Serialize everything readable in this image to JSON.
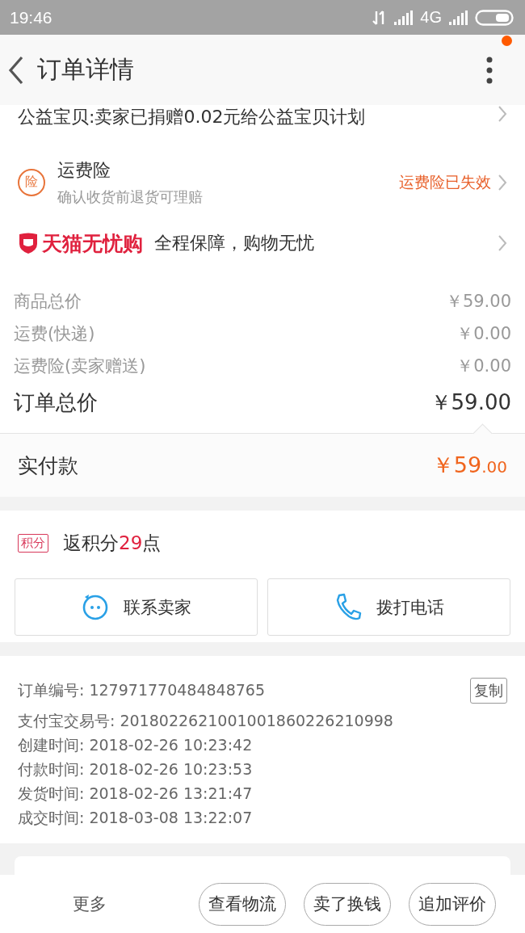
{
  "status_bar": {
    "time": "19:46",
    "network": "4G"
  },
  "header": {
    "title": "订单详情",
    "notification": true
  },
  "charity": {
    "text": "公益宝贝:卖家已捐赠0.02元给公益宝贝计划"
  },
  "insurance": {
    "badge": "险",
    "title": "运费险",
    "subtitle": "确认收货前退货可理赔",
    "status": "运费险已失效"
  },
  "tmall": {
    "brand": "天猫无忧购",
    "slogan": "全程保障，购物无忧"
  },
  "price_rows": [
    {
      "kind": "sub",
      "label": "商品总价",
      "value": "￥59.00"
    },
    {
      "kind": "sub",
      "label": "运费(快递)",
      "value": "￥0.00"
    },
    {
      "kind": "sub",
      "label": "运费险(卖家赠送)",
      "value": "￥0.00"
    },
    {
      "kind": "total",
      "label": "订单总价",
      "value": "￥59.00"
    }
  ],
  "paid": {
    "label": "实付款",
    "amount": "￥59",
    "cents": ".00"
  },
  "points": {
    "badge": "积分",
    "prefix": "返积分",
    "number": "29",
    "suffix": "点"
  },
  "contact_buttons": [
    {
      "kind": "chat",
      "label": "联系卖家"
    },
    {
      "kind": "phone",
      "label": "拨打电话"
    }
  ],
  "order_info": [
    {
      "label": "订单编号:",
      "value": "127971770484848765"
    },
    {
      "label": "支付宝交易号:",
      "value": "2018022621001001860226210998"
    },
    {
      "label": "创建时间:",
      "value": "2018-02-26 10:23:42"
    },
    {
      "label": "付款时间:",
      "value": "2018-02-26 10:23:53"
    },
    {
      "label": "发货时间:",
      "value": "2018-02-26 13:21:47"
    },
    {
      "label": "成交时间:",
      "value": "2018-03-08 13:22:07"
    }
  ],
  "copy_button": "复制",
  "bottom_bar": {
    "more": "更多",
    "buttons": [
      "查看物流",
      "卖了换钱",
      "追加评价"
    ]
  }
}
